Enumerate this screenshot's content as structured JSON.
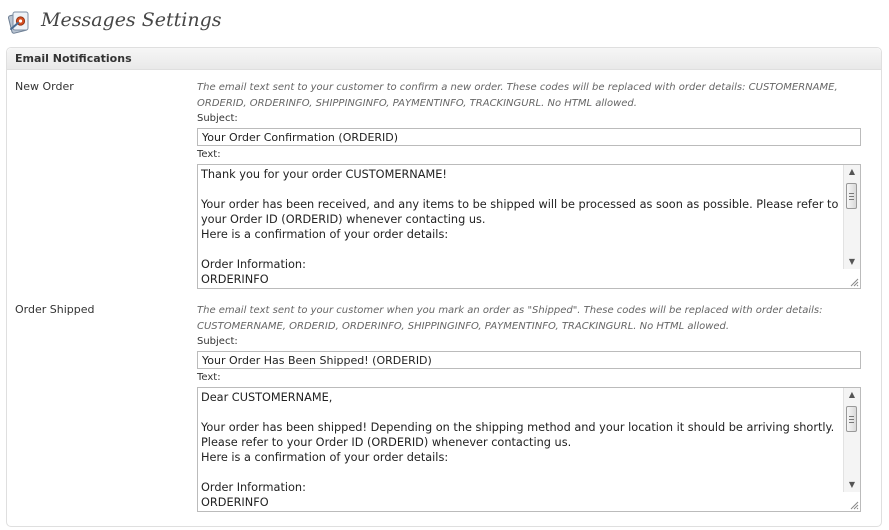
{
  "page": {
    "title": "Messages Settings",
    "icon": "settings-page-icon"
  },
  "section": {
    "title": "Email Notifications"
  },
  "notifications": [
    {
      "label": "New Order",
      "description": "The email text sent to your customer to confirm a new order. These codes will be replaced with order details: CUSTOMERNAME, ORDERID, ORDERINFO, SHIPPINGINFO, PAYMENTINFO, TRACKINGURL. No HTML allowed.",
      "subject_label": "Subject:",
      "subject_value": "Your Order Confirmation (ORDERID)",
      "text_label": "Text:",
      "text_value": "Thank you for your order CUSTOMERNAME!\n\nYour order has been received, and any items to be shipped will be processed as soon as possible. Please refer to your Order ID (ORDERID) whenever contacting us.\nHere is a confirmation of your order details:\n\nOrder Information:\nORDERINFO"
    },
    {
      "label": "Order Shipped",
      "description": "The email text sent to your customer when you mark an order as \"Shipped\". These codes will be replaced with order details: CUSTOMERNAME, ORDERID, ORDERINFO, SHIPPINGINFO, PAYMENTINFO, TRACKINGURL. No HTML allowed.",
      "subject_label": "Subject:",
      "subject_value": "Your Order Has Been Shipped! (ORDERID)",
      "text_label": "Text:",
      "text_value": "Dear CUSTOMERNAME,\n\nYour order has been shipped! Depending on the shipping method and your location it should be arriving shortly. Please refer to your Order ID (ORDERID) whenever contacting us.\nHere is a confirmation of your order details:\n\nOrder Information:\nORDERINFO"
    }
  ],
  "colors": {
    "border": "#dfdfdf",
    "title_text": "#464646",
    "description_text": "#666666"
  }
}
